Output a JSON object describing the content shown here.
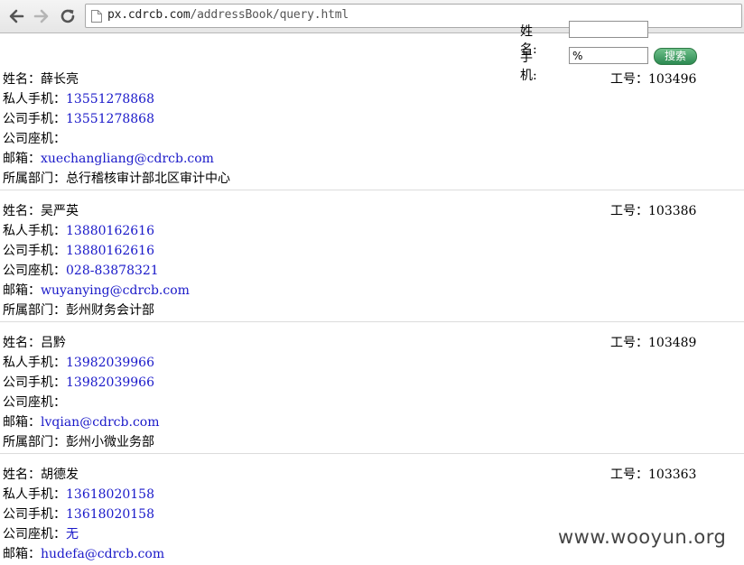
{
  "browser": {
    "url_host": "px.cdrcb.com",
    "url_path": "/addressBook/query.html"
  },
  "search": {
    "name_label": "姓名:",
    "name_value": "",
    "phone_label": "手机:",
    "phone_value": "%",
    "button_label": "搜索"
  },
  "labels": {
    "name": "姓名：",
    "empno": "工号：",
    "private_phone": "私人手机：",
    "company_phone": "公司手机：",
    "landline": "公司座机：",
    "email": "邮箱：",
    "dept": "所属部门："
  },
  "records": [
    {
      "name": "薛长亮",
      "empno": "103496",
      "private_phone": "13551278868",
      "company_phone": "13551278868",
      "landline": "",
      "email": "xuechangliang@cdrcb.com",
      "dept": "总行稽核审计部北区审计中心"
    },
    {
      "name": "吴严英",
      "empno": "103386",
      "private_phone": "13880162616",
      "company_phone": "13880162616",
      "landline": "028-83878321",
      "email": "wuyanying@cdrcb.com",
      "dept": "彭州财务会计部"
    },
    {
      "name": "吕黔",
      "empno": "103489",
      "private_phone": "13982039966",
      "company_phone": "13982039966",
      "landline": "",
      "email": "lvqian@cdrcb.com",
      "dept": "彭州小微业务部"
    },
    {
      "name": "胡德发",
      "empno": "103363",
      "private_phone": "13618020158",
      "company_phone": "13618020158",
      "landline": "无",
      "email": "hudefa@cdrcb.com",
      "dept": ""
    }
  ],
  "watermark": "www.wooyun.org"
}
